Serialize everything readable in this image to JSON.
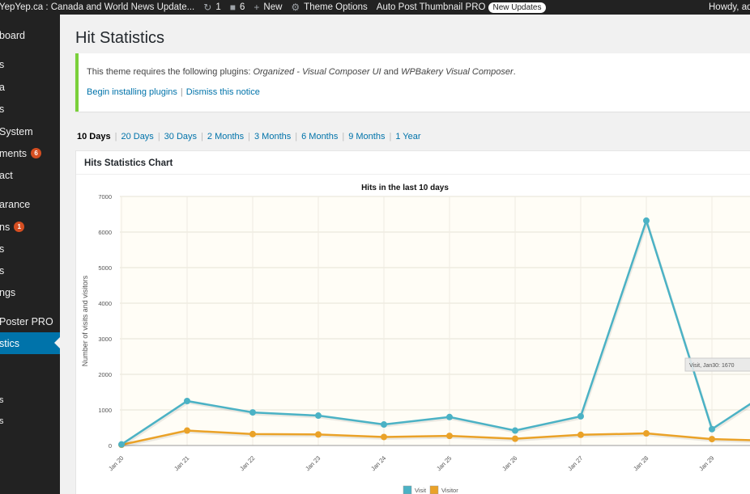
{
  "adminbar": {
    "site_title": "YepYep.ca : Canada and World News Update...",
    "updates_count": "1",
    "comments_count": "6",
    "new_label": "New",
    "theme_options_label": "Theme Options",
    "plugin_label": "Auto Post Thumbnail PRO",
    "plugin_badge": "New Updates",
    "howdy": "Howdy, ad"
  },
  "sidebar": {
    "items": [
      {
        "label": "board"
      },
      {
        "label": "s"
      },
      {
        "label": "a"
      },
      {
        "label": "s"
      },
      {
        "label": "System"
      },
      {
        "label": "ments",
        "count": "6"
      },
      {
        "label": "act"
      },
      {
        "label": "arance"
      },
      {
        "label": "ns",
        "count": "1"
      },
      {
        "label": "s"
      },
      {
        "label": "s"
      },
      {
        "label": "ngs"
      },
      {
        "label": "Poster PRO"
      },
      {
        "label": "stics"
      },
      {
        "label": "s"
      },
      {
        "label": "s"
      }
    ]
  },
  "page": {
    "title": "Hit Statistics"
  },
  "notice": {
    "text_prefix": "This theme requires the following plugins: ",
    "plugin1": "Organized - Visual Composer UI",
    "text_and": " and ",
    "plugin2": "WPBakery Visual Composer",
    "text_suffix": ".",
    "begin_link": "Begin installing plugins",
    "separator": "|",
    "dismiss_link": "Dismiss this notice"
  },
  "ranges": {
    "items": [
      "10 Days",
      "20 Days",
      "30 Days",
      "2 Months",
      "3 Months",
      "6 Months",
      "9 Months",
      "1 Year"
    ],
    "separator": "|"
  },
  "panel": {
    "title": "Hits Statistics Chart"
  },
  "chart_data": {
    "type": "line",
    "title": "Hits in the last 10 days",
    "ylabel": "Number of visits and visitors",
    "xlabel": "",
    "categories": [
      "Jan 20",
      "Jan 21",
      "Jan 22",
      "Jan 23",
      "Jan 24",
      "Jan 25",
      "Jan 26",
      "Jan 27",
      "Jan 28",
      "Jan 29",
      "Jan 30"
    ],
    "ylim": [
      0,
      7000
    ],
    "yticks": [
      0,
      1000,
      2000,
      3000,
      4000,
      5000,
      6000,
      7000
    ],
    "series": [
      {
        "name": "Visit",
        "color": "#4bb2c5",
        "values": [
          30,
          1250,
          930,
          840,
          590,
          800,
          420,
          820,
          6320,
          460,
          1670
        ]
      },
      {
        "name": "Visitor",
        "color": "#eaa228",
        "values": [
          20,
          420,
          320,
          310,
          240,
          270,
          190,
          300,
          340,
          180,
          130
        ]
      }
    ],
    "grid": true,
    "legend_position": "bottom",
    "plot_background": "#fffdf6",
    "tooltip": "Visit, Jan30: 1670"
  }
}
